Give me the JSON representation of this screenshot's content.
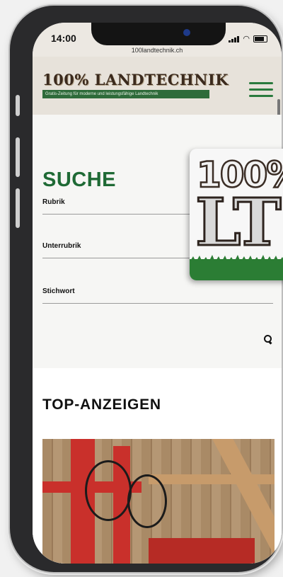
{
  "status_bar": {
    "time": "14:00",
    "url": "100landtechnik.ch"
  },
  "header": {
    "logo_title": "100% LANDTECHNIK",
    "logo_tagline": "Gratis-Zeitung für moderne und leistungsfähige Landtechnik",
    "menu_icon": "hamburger-icon"
  },
  "search": {
    "title": "SUCHE",
    "fields": [
      {
        "label": "Rubrik",
        "value": ""
      },
      {
        "label": "Unterrubrik",
        "value": ""
      },
      {
        "label": "Stichwort",
        "value": ""
      }
    ],
    "submit_icon": "search-icon"
  },
  "top_ads": {
    "title": "TOP-ANZEIGEN"
  },
  "badge": {
    "top_text": "100%",
    "main_text": "LT"
  },
  "colors": {
    "brand_green": "#1f6a35",
    "header_bg": "#e7e2da",
    "logo_brown": "#3b2a1d",
    "grass_green": "#2b7d34"
  }
}
